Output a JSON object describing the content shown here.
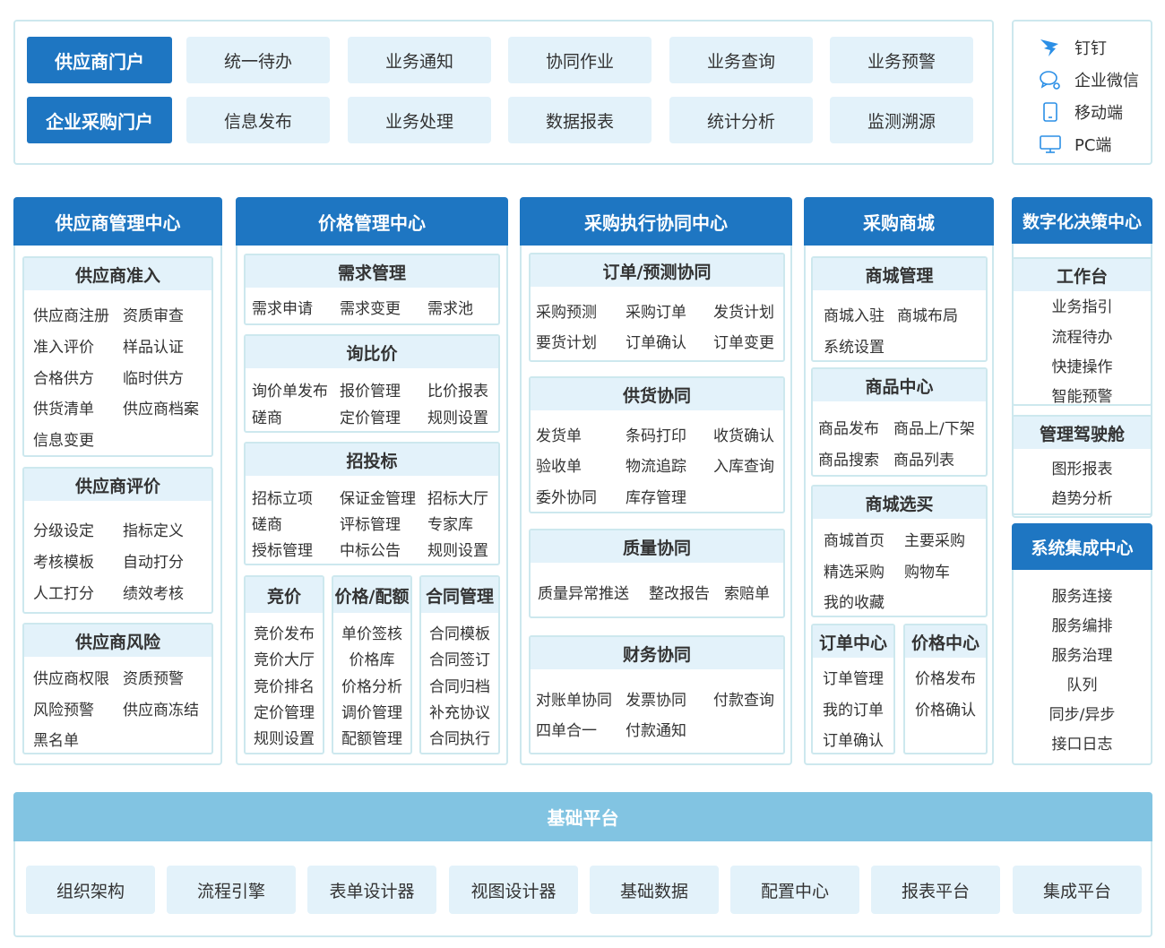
{
  "portals": {
    "supplier": "供应商门户",
    "enterprise": "企业采购门户",
    "row1": [
      "统一待办",
      "业务通知",
      "协同作业",
      "业务查询",
      "业务预警"
    ],
    "row2": [
      "信息发布",
      "业务处理",
      "数据报表",
      "统计分析",
      "监测溯源"
    ]
  },
  "channels": [
    {
      "icon": "dingtalk-icon",
      "label": "钉钉"
    },
    {
      "icon": "wechat-work-icon",
      "label": "企业微信"
    },
    {
      "icon": "mobile-icon",
      "label": "移动端"
    },
    {
      "icon": "pc-icon",
      "label": "PC端"
    }
  ],
  "supplier_center": {
    "title": "供应商管理中心",
    "access": {
      "title": "供应商准入",
      "items": [
        "供应商注册",
        "资质审查",
        "准入评价",
        "样品认证",
        "合格供方",
        "临时供方",
        "供货清单",
        "供应商档案",
        "信息变更"
      ]
    },
    "evaluation": {
      "title": "供应商评价",
      "items": [
        "分级设定",
        "指标定义",
        "考核模板",
        "自动打分",
        "人工打分",
        "绩效考核"
      ]
    },
    "risk": {
      "title": "供应商风险",
      "items": [
        "供应商权限",
        "资质预警",
        "风险预警",
        "供应商冻结",
        "黑名单"
      ]
    }
  },
  "price_center": {
    "title": "价格管理中心",
    "demand": {
      "title": "需求管理",
      "items": [
        "需求申请",
        "需求变更",
        "需求池"
      ]
    },
    "inquiry": {
      "title": "询比价",
      "items": [
        "询价单发布",
        "报价管理",
        "比价报表",
        "磋商",
        "定价管理",
        "规则设置"
      ]
    },
    "bidding": {
      "title": "招投标",
      "items": [
        "招标立项",
        "保证金管理",
        "招标大厅",
        "磋商",
        "评标管理",
        "专家库",
        "授标管理",
        "中标公告",
        "规则设置"
      ]
    },
    "auction": {
      "title": "竞价",
      "items": [
        "竞价发布",
        "竞价大厅",
        "竞价排名",
        "定价管理",
        "规则设置"
      ]
    },
    "quota": {
      "title": "价格/配额",
      "items": [
        "单价签核",
        "价格库",
        "价格分析",
        "调价管理",
        "配额管理"
      ]
    },
    "contract": {
      "title": "合同管理",
      "items": [
        "合同模板",
        "合同签订",
        "合同归档",
        "补充协议",
        "合同执行"
      ]
    }
  },
  "execution_center": {
    "title": "采购执行协同中心",
    "order": {
      "title": "订单/预测协同",
      "items": [
        "采购预测",
        "采购订单",
        "发货计划",
        "要货计划",
        "订单确认",
        "订单变更"
      ]
    },
    "supply": {
      "title": "供货协同",
      "items": [
        "发货单",
        "条码打印",
        "收货确认",
        "验收单",
        "物流追踪",
        "入库查询",
        "委外协同",
        "库存管理"
      ]
    },
    "quality": {
      "title": "质量协同",
      "items": [
        "质量异常推送",
        "整改报告",
        "索赔单"
      ]
    },
    "finance": {
      "title": "财务协同",
      "items": [
        "对账单协同",
        "发票协同",
        "付款查询",
        "四单合一",
        "付款通知"
      ]
    }
  },
  "mall": {
    "title": "采购商城",
    "manage": {
      "title": "商城管理",
      "items": [
        "商城入驻",
        "商城布局",
        "系统设置"
      ]
    },
    "goods": {
      "title": "商品中心",
      "items": [
        "商品发布",
        "商品上/下架",
        "商品搜索",
        "商品列表"
      ]
    },
    "select": {
      "title": "商城选买",
      "items": [
        "商城首页",
        "主要采购",
        "精选采购",
        "购物车",
        "我的收藏"
      ]
    },
    "orders": {
      "title": "订单中心",
      "items": [
        "订单管理",
        "我的订单",
        "订单确认"
      ]
    },
    "prices": {
      "title": "价格中心",
      "items": [
        "价格发布",
        "价格确认"
      ]
    }
  },
  "decision": {
    "title": "数字化决策中心",
    "workbench": {
      "title": "工作台",
      "items": [
        "业务指引",
        "流程待办",
        "快捷操作",
        "智能预警"
      ]
    },
    "cockpit": {
      "title": "管理驾驶舱",
      "items": [
        "图形报表",
        "趋势分析"
      ]
    }
  },
  "integration": {
    "title": "系统集成中心",
    "items": [
      "服务连接",
      "服务编排",
      "服务治理",
      "队列",
      "同步/异步",
      "接口日志"
    ]
  },
  "base": {
    "title": "基础平台",
    "items": [
      "组织架构",
      "流程引擎",
      "表单设计器",
      "视图设计器",
      "基础数据",
      "配置中心",
      "报表平台",
      "集成平台"
    ]
  },
  "colors": {
    "primary": "#1e76c2",
    "light": "#e3f2fa",
    "border": "#cde8ee",
    "base": "#82c4e2"
  }
}
